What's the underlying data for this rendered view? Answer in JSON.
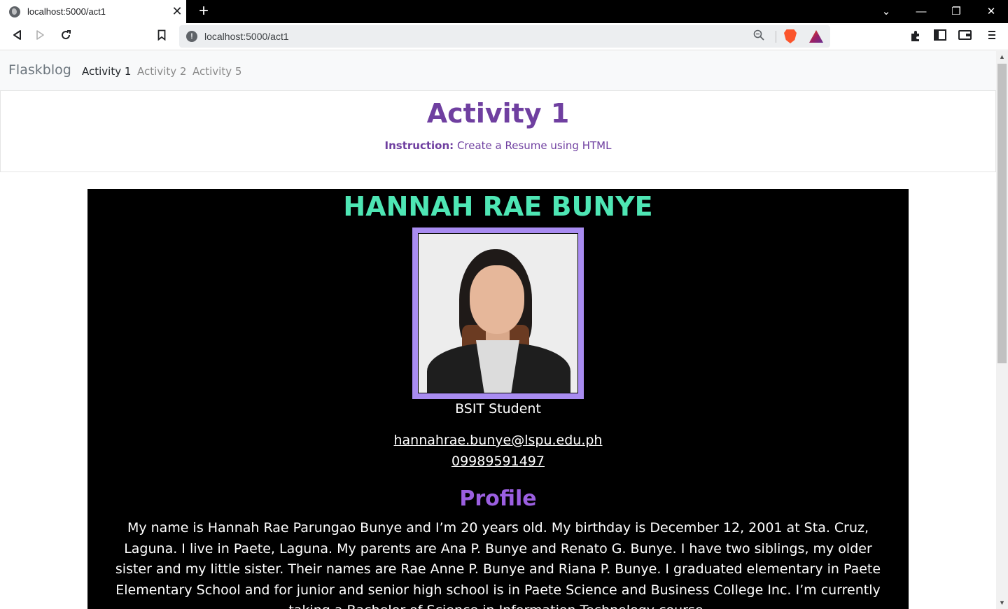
{
  "browser": {
    "tab_title": "localhost:5000/act1",
    "url": "localhost:5000/act1",
    "new_tab_label": "+",
    "tab_close": "✕",
    "win_dropdown": "⌄",
    "win_minimize": "—",
    "win_restore": "❐",
    "win_close": "✕"
  },
  "site": {
    "brand": "Flaskblog",
    "nav": [
      "Activity 1",
      "Activity 2",
      "Activity 5"
    ]
  },
  "header": {
    "title": "Activity 1",
    "instruction_label": "Instruction:",
    "instruction_text": " Create a Resume using HTML"
  },
  "resume": {
    "name": "HANNAH RAE BUNYE",
    "role": "BSIT Student",
    "email": "hannahrae.bunye@lspu.edu.ph",
    "phone": "09989591497",
    "profile_heading": "Profile",
    "profile_text": "My name is Hannah Rae Parungao Bunye and I’m 20 years old. My birthday is December 12, 2001 at Sta. Cruz, Laguna. I live in Paete, Laguna. My parents are Ana P. Bunye and Renato G. Bunye. I have two siblings, my older sister and my little sister. Their names are Rae Anne P. Bunye and Riana P. Bunye. I graduated elementary in Paete Elementary School and for junior and senior high school is in Paete Science and Business College Inc. I’m currently taking a Bachelor of Science in Information Technology course."
  },
  "colors": {
    "name": "#4ee6b4",
    "header_purple": "#6f3fa0",
    "profile_heading": "#9b5fe0",
    "photo_frame": "#a98cf1"
  }
}
